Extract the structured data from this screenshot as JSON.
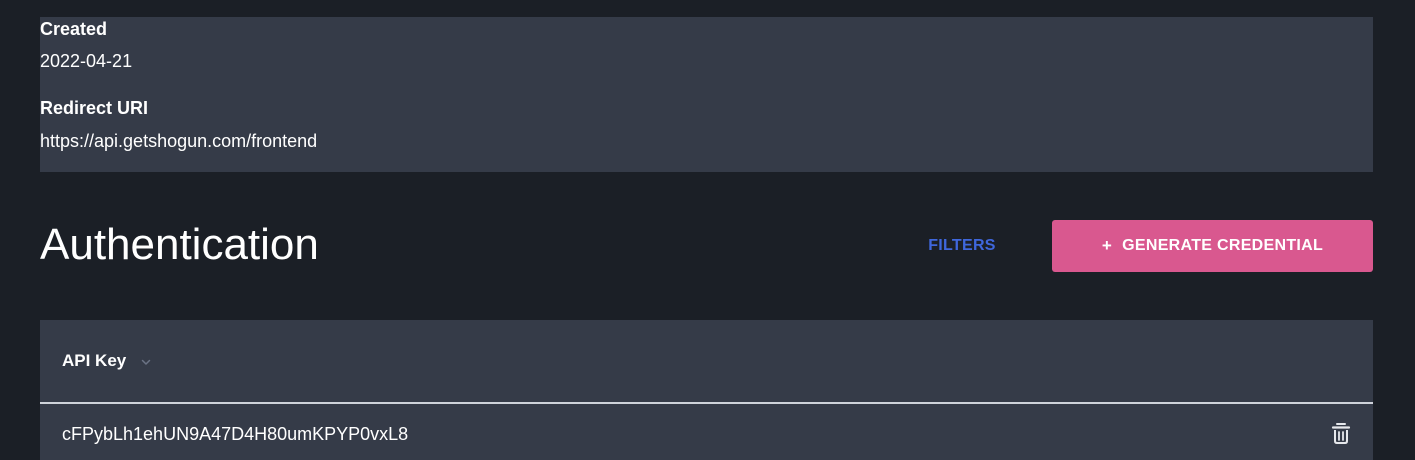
{
  "details": {
    "created_label": "Created",
    "created_value": "2022-04-21",
    "redirect_label": "Redirect URI",
    "redirect_value": "https://api.getshogun.com/frontend"
  },
  "authentication": {
    "title": "Authentication",
    "filters_label": "FILTERS",
    "generate_label": "GENERATE CREDENTIAL",
    "generate_icon": "+"
  },
  "table": {
    "columns": [
      {
        "label": "API Key",
        "icon": "chevron-down-icon"
      }
    ],
    "rows": [
      {
        "api_key": "cFPybLh1ehUN9A47D4H80umKPYP0vxL8",
        "action_icon": "trash-icon"
      }
    ]
  },
  "colors": {
    "page_background": "#1b1f26",
    "card_background": "#353b48",
    "accent_pink": "#d9588f",
    "link_blue": "#3f67dc"
  }
}
